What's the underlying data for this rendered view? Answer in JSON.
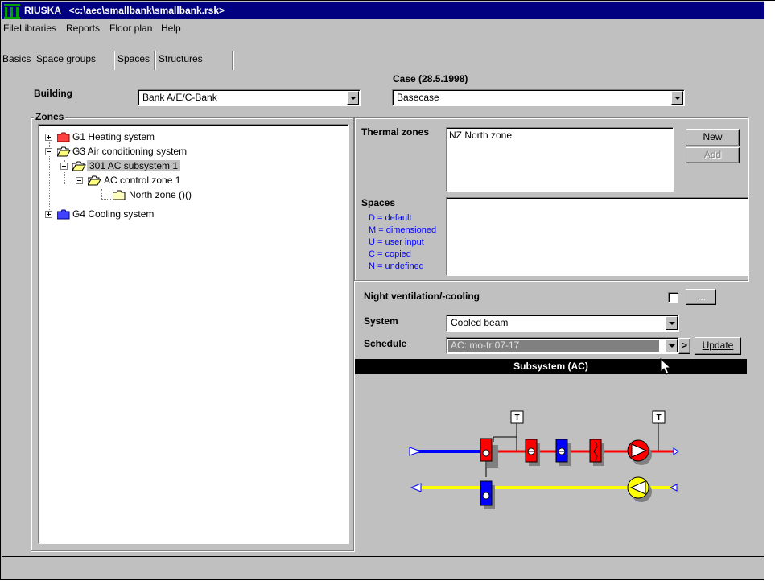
{
  "titlebar": {
    "app": "RIUSKA",
    "path": "<c:\\aec\\smallbank\\smallbank.rsk>"
  },
  "menu": [
    "File",
    "Libraries",
    "Reports",
    "Floor plan",
    "Help"
  ],
  "tabs": [
    "Basics",
    "Space groups",
    "Spaces",
    "Structures"
  ],
  "building": {
    "label": "Building",
    "value": "Bank  A/E/C-Bank"
  },
  "case": {
    "label": "Case  (28.5.1998)",
    "value": "Basecase"
  },
  "zones": {
    "label": "Zones",
    "tree": [
      {
        "text": "G1  Heating system",
        "folder_color": "#ff4040"
      },
      {
        "text": "G3  Air conditioning system"
      },
      {
        "text": "301  AC subsystem 1"
      },
      {
        "text": "AC control zone 1"
      },
      {
        "text": "North zone  ()()"
      },
      {
        "text": "G4  Cooling system",
        "folder_color": "#4040ff"
      }
    ]
  },
  "thermal_zones": {
    "label": "Thermal zones",
    "items": [
      "NZ  North zone"
    ]
  },
  "buttons": {
    "new": "New",
    "add": "Add",
    "more": "...",
    "update": "Update",
    "next": ">"
  },
  "spaces": {
    "label": "Spaces",
    "legend": [
      "D = default",
      "M = dimensioned",
      "U = user input",
      "C = copied",
      "N = undefined"
    ]
  },
  "night_ventilation": {
    "label": "Night ventilation/-cooling",
    "checked": false
  },
  "system": {
    "label": "System",
    "value": "Cooled beam"
  },
  "schedule": {
    "label": "Schedule",
    "value": "AC: mo-fr 07-17"
  },
  "subsystem": {
    "title": "Subsystem (AC)",
    "thermostat_label": "T"
  },
  "colors": {
    "title_bar": "#000080",
    "supply_duct": "#0000ff",
    "exhaust_duct": "#ffff00",
    "heater": "#ff0000",
    "cooler": "#0000ff",
    "legend_text": "#0000ff"
  }
}
